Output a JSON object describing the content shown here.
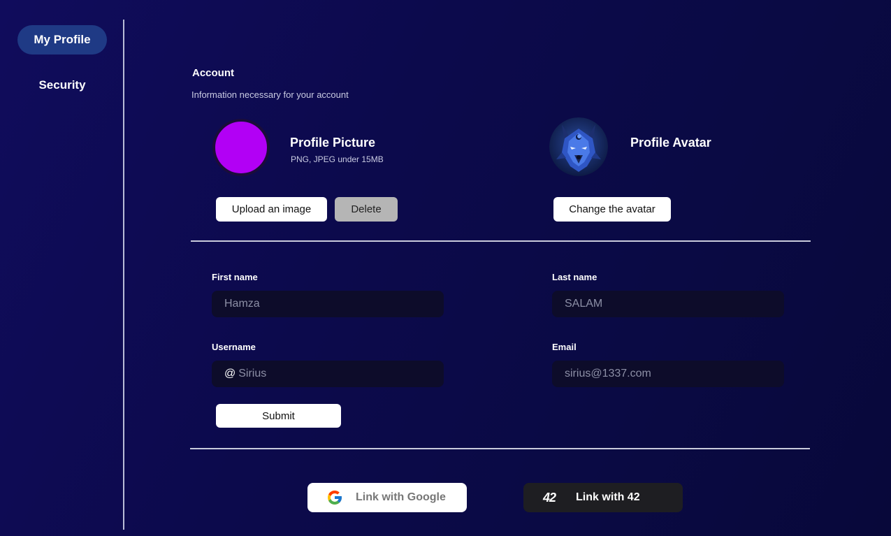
{
  "sidebar": {
    "items": [
      {
        "label": "My Profile",
        "active": true
      },
      {
        "label": "Security",
        "active": false
      }
    ]
  },
  "account": {
    "title": "Account",
    "subtitle": "Information necessary for your account"
  },
  "profile_picture": {
    "title": "Profile Picture",
    "subtitle": "PNG, JPEG under 15MB",
    "color": "#b200f5",
    "upload_label": "Upload an image",
    "delete_label": "Delete"
  },
  "profile_avatar": {
    "title": "Profile Avatar",
    "image": "wolf-avatar-icon",
    "change_label": "Change the avatar"
  },
  "form": {
    "first_name": {
      "label": "First name",
      "placeholder": "Hamza"
    },
    "last_name": {
      "label": "Last name",
      "placeholder": "SALAM"
    },
    "username": {
      "label": "Username",
      "prefix": "@",
      "placeholder": "Sirius"
    },
    "email": {
      "label": "Email",
      "placeholder": "sirius@1337.com"
    },
    "submit_label": "Submit"
  },
  "links": {
    "google_label": "Link with Google",
    "ft_label": "Link with 42",
    "ft_logo": "42"
  },
  "colors": {
    "accent": "#1f3a85",
    "input_bg": "#0d0c2a",
    "ft_button_bg": "#1e1e22"
  }
}
